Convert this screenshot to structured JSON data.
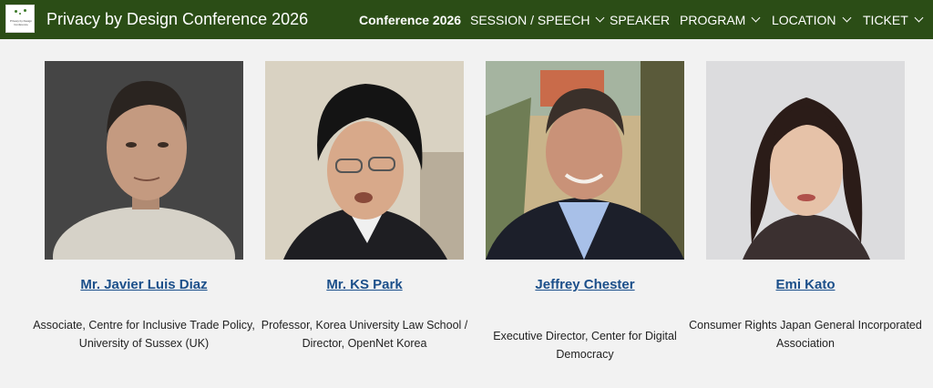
{
  "header": {
    "site_title": "Privacy by Design Conference 2026",
    "logo_text": "Privacy by Design Conference"
  },
  "nav": [
    {
      "label": "Conference 2026",
      "dropdown": false
    },
    {
      "label": "SESSION / SPEECH",
      "dropdown": true
    },
    {
      "label": "SPEAKER",
      "dropdown": false
    },
    {
      "label": "PROGRAM",
      "dropdown": true
    },
    {
      "label": "LOCATION",
      "dropdown": true
    },
    {
      "label": "TICKET",
      "dropdown": true
    }
  ],
  "speakers": [
    {
      "name": "Mr. Javier Luis Diaz",
      "role": "Associate, Centre for Inclusive Trade Policy, University of Sussex (UK)"
    },
    {
      "name": "Mr. KS Park",
      "role": "Professor, Korea University Law School / Director, OpenNet Korea"
    },
    {
      "name": "Jeffrey Chester",
      "role": "Executive Director, Center for Digital Democracy"
    },
    {
      "name": "Emi Kato",
      "role": "Consumer Rights Japan General Incorporated Association"
    }
  ],
  "colors": {
    "header_bg": "#2b4d16",
    "link": "#1b4f8a",
    "page_bg": "#f2f2f2"
  },
  "icons": {
    "dropdown": "chevron-down-icon"
  }
}
